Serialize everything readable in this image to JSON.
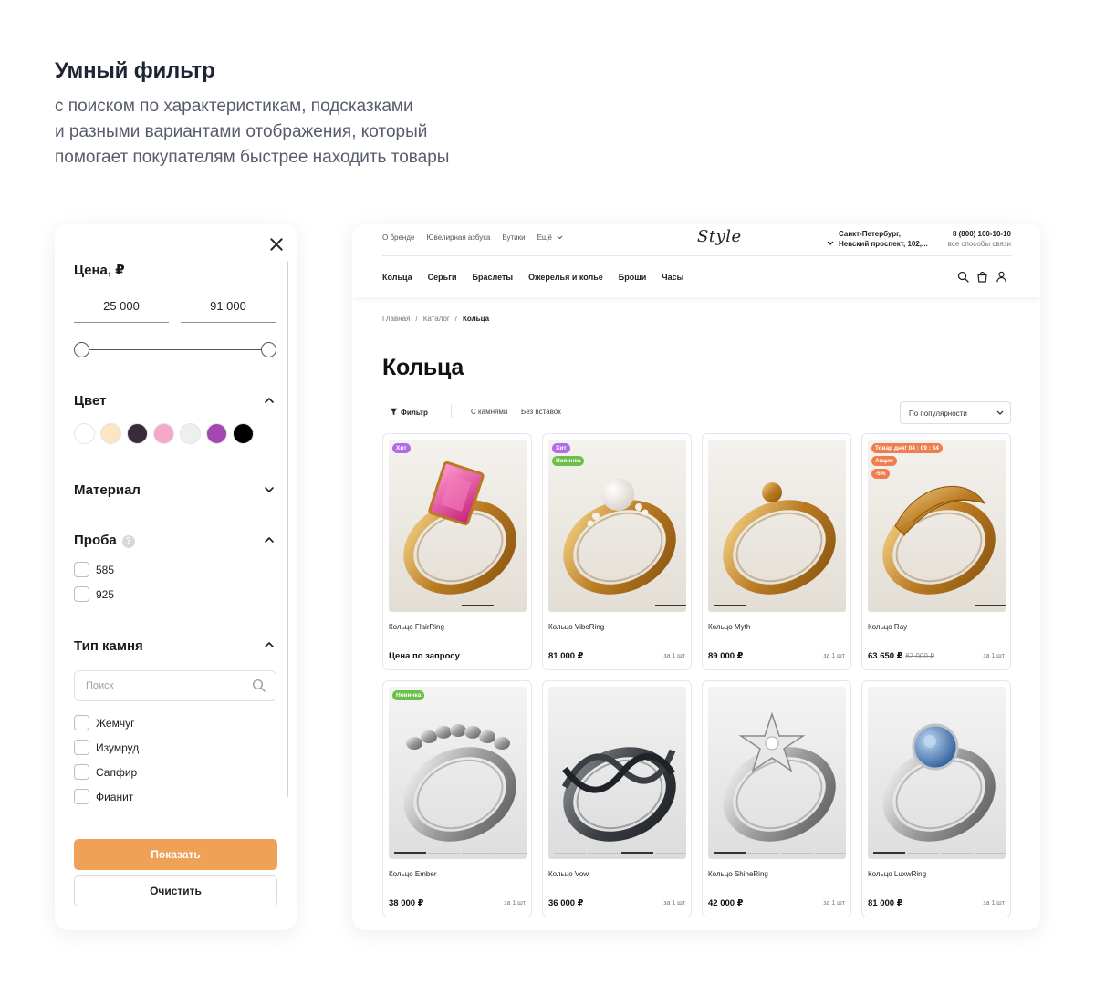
{
  "hero": {
    "title": "Умный фильтр",
    "subtitle_lines": [
      "с поиском по характеристикам, подсказками",
      "и разными вариантами отображения, который",
      "помогает покупателям быстрее находить товары"
    ]
  },
  "filter": {
    "price_label": "Цена, ₽",
    "price_min": "25 000",
    "price_max": "91 000",
    "color_label": "Цвет",
    "colors": [
      "#ffffff",
      "#fde4c4",
      "#3a2a3b",
      "#f7a7c7",
      "#eef0f0",
      "#a646b0",
      "#000000"
    ],
    "material_label": "Материал",
    "assay_label": "Проба",
    "assay_help": "?",
    "assay_options": [
      "585",
      "925"
    ],
    "stone_label": "Тип камня",
    "stone_search_placeholder": "Поиск",
    "stone_options": [
      "Жемчуг",
      "Изумруд",
      "Сапфир",
      "Фианит"
    ],
    "show_button": "Показать",
    "clear_button": "Очистить"
  },
  "shop": {
    "top_nav": [
      "О бренде",
      "Ювелирная азбука",
      "Бутики",
      "Ещё"
    ],
    "logo": "Style",
    "address_lines": [
      "Санкт-Петербург,",
      "Невский проспект, 102,..."
    ],
    "phone": "8 (800) 100-10-10",
    "phone_sub": "все способы связи",
    "categories": [
      "Кольца",
      "Серьги",
      "Браслеты",
      "Ожерелья и колье",
      "Броши",
      "Часы"
    ],
    "breadcrumb": [
      "Главная",
      "Каталог",
      "Кольца"
    ],
    "breadcrumb_sep": "/",
    "page_title": "Кольца",
    "toolbar": {
      "filter": "Фильтр",
      "with_stones": "С камнями",
      "no_stones": "Без вставок"
    },
    "sort": "По популярности",
    "accent_colors": {
      "hit": "#b26be8",
      "new": "#6cc04a",
      "deal": "#ef7d4d",
      "button": "#f0a158"
    },
    "products": [
      {
        "name": "Кольцо FlairRing",
        "price": "Цена по запросу",
        "old_price": "",
        "unit": "",
        "badges": [
          "Хит"
        ],
        "metal": "gold",
        "stone": "pink",
        "active_dot": 2
      },
      {
        "name": "Кольцо VibeRing",
        "price": "81 000 ₽",
        "old_price": "",
        "unit": "за 1 шт",
        "badges": [
          "Хит",
          "Новинка"
        ],
        "metal": "gold",
        "stone": "pearl",
        "active_dot": 3
      },
      {
        "name": "Кольцо Myth",
        "price": "89 000 ₽",
        "old_price": "",
        "unit": "за 1 шт",
        "badges": [],
        "metal": "gold",
        "stone": "ball",
        "active_dot": 0
      },
      {
        "name": "Кольцо Ray",
        "price": "63 650 ₽",
        "old_price": "67 000 ₽",
        "unit": "за 1 шт",
        "badges": [
          "Товар дня! 04 : 09 : 34",
          "Акция",
          "-5%"
        ],
        "metal": "gold",
        "stone": "leaf",
        "active_dot": 3
      },
      {
        "name": "Кольцо Ember",
        "price": "38 000 ₽",
        "old_price": "",
        "unit": "за 1 шт",
        "badges": [
          "Новинка"
        ],
        "metal": "silver",
        "stone": "beads",
        "active_dot": 0
      },
      {
        "name": "Кольцо Vow",
        "price": "36 000 ₽",
        "old_price": "",
        "unit": "за 1 шт",
        "badges": [],
        "metal": "dark",
        "stone": "twist",
        "active_dot": 2
      },
      {
        "name": "Кольцо ShineRing",
        "price": "42 000 ₽",
        "old_price": "",
        "unit": "за 1 шт",
        "badges": [],
        "metal": "silver",
        "stone": "star",
        "active_dot": 0
      },
      {
        "name": "Кольцо LuxwRing",
        "price": "81 000 ₽",
        "old_price": "",
        "unit": "за 1 шт",
        "badges": [],
        "metal": "silver",
        "stone": "blue",
        "active_dot": 0
      }
    ]
  }
}
